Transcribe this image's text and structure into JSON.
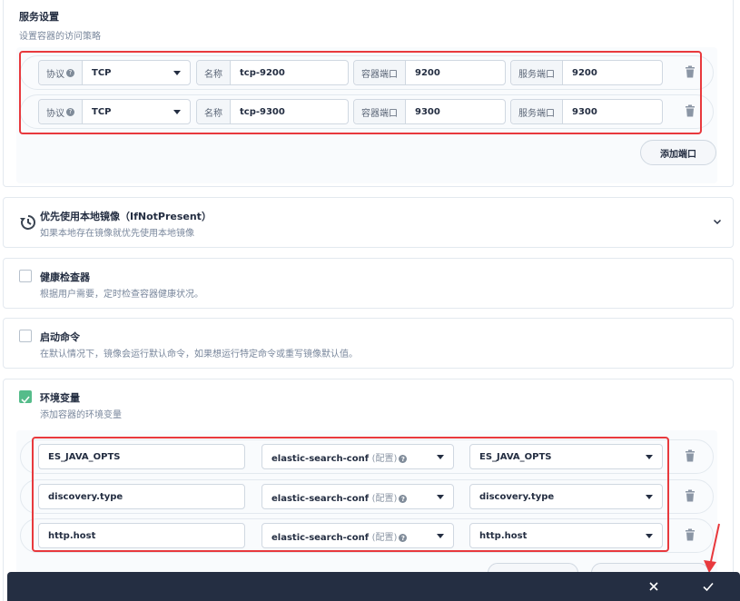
{
  "service": {
    "title": "服务设置",
    "desc": "设置容器的访问策略",
    "label_protocol": "协议",
    "label_name": "名称",
    "label_container_port": "容器端口",
    "label_service_port": "服务端口",
    "ports": [
      {
        "protocol": "TCP",
        "name": "tcp-9200",
        "container_port": "9200",
        "service_port": "9200"
      },
      {
        "protocol": "TCP",
        "name": "tcp-9300",
        "container_port": "9300",
        "service_port": "9300"
      }
    ],
    "add_port_label": "添加端口"
  },
  "image_pull": {
    "title": "优先使用本地镜像（IfNotPresent）",
    "desc": "如果本地存在镜像就优先使用本地镜像"
  },
  "health_check": {
    "title": "健康检查器",
    "desc": "根据用户需要，定时检查容器健康状况。",
    "checked": false
  },
  "start_command": {
    "title": "启动命令",
    "desc": "在默认情况下，镜像会运行默认命令，如果想运行特定命令或重写镜像默认值。",
    "checked": false
  },
  "env": {
    "title": "环境变量",
    "desc": "添加容器的环境变量",
    "checked": true,
    "config_suffix": "(配置)",
    "rows": [
      {
        "name": "ES_JAVA_OPTS",
        "source": "elastic-search-conf",
        "key": "ES_JAVA_OPTS"
      },
      {
        "name": "discovery.type",
        "source": "elastic-search-conf",
        "key": "discovery.type"
      },
      {
        "name": "http.host",
        "source": "elastic-search-conf",
        "key": "http.host"
      }
    ]
  },
  "colors": {
    "accent": "#55bc8a",
    "highlight": "#e8393d",
    "bar": "#242e42"
  }
}
